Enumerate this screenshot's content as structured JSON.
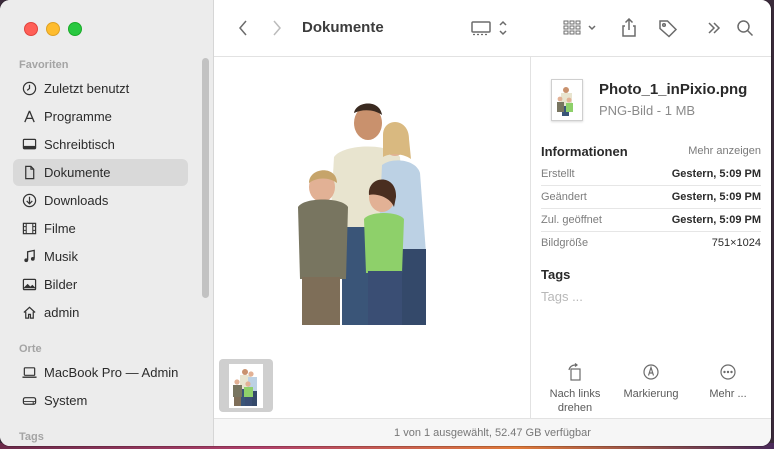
{
  "window": {
    "title": "Dokumente"
  },
  "sidebar": {
    "favorites_label": "Favoriten",
    "favorites": [
      {
        "label": "Zuletzt benutzt",
        "icon": "clock-icon"
      },
      {
        "label": "Programme",
        "icon": "apps-icon"
      },
      {
        "label": "Schreibtisch",
        "icon": "desktop-icon"
      },
      {
        "label": "Dokumente",
        "icon": "document-icon",
        "active": true
      },
      {
        "label": "Downloads",
        "icon": "download-icon"
      },
      {
        "label": "Filme",
        "icon": "film-icon"
      },
      {
        "label": "Musik",
        "icon": "music-icon"
      },
      {
        "label": "Bilder",
        "icon": "photo-icon"
      },
      {
        "label": "admin",
        "icon": "home-icon"
      }
    ],
    "locations_label": "Orte",
    "locations": [
      {
        "label": "MacBook Pro — Admin",
        "icon": "laptop-icon"
      },
      {
        "label": "System",
        "icon": "disk-icon"
      }
    ],
    "tags_label": "Tags"
  },
  "info": {
    "file_name": "Photo_1_inPixio.png",
    "file_kind": "PNG-Bild - 1 MB",
    "section_title": "Informationen",
    "show_more": "Mehr anzeigen",
    "rows": [
      {
        "key": "Erstellt",
        "value": "Gestern, 5:09 PM"
      },
      {
        "key": "Geändert",
        "value": "Gestern, 5:09 PM"
      },
      {
        "key": "Zul. geöffnet",
        "value": "Gestern, 5:09 PM"
      },
      {
        "key": "Bildgröße",
        "value": "751×1024"
      }
    ],
    "tags_title": "Tags",
    "tags_placeholder": "Tags ...",
    "actions": [
      {
        "line1": "Nach links",
        "line2": "drehen",
        "icon": "rotate-left-icon"
      },
      {
        "line1": "Markierung",
        "line2": "",
        "icon": "markup-icon"
      },
      {
        "line1": "Mehr ...",
        "line2": "",
        "icon": "more-icon"
      }
    ]
  },
  "status": {
    "text": "1 von 1 ausgewählt, 52.47 GB verfügbar"
  },
  "colors": {
    "accent_red": "#ff5f57",
    "accent_yellow": "#febc2e",
    "accent_green": "#28c840",
    "sidebar_bg": "#ececec"
  }
}
